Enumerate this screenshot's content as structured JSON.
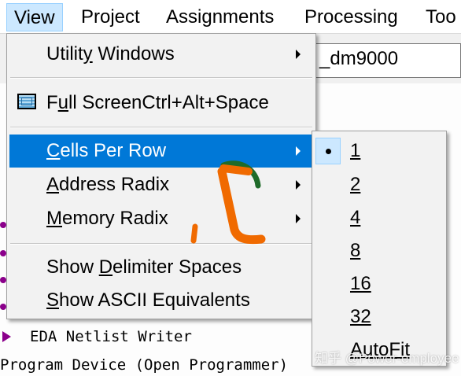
{
  "menubar": {
    "items": [
      {
        "label": "View",
        "active": true
      },
      {
        "label": "Project"
      },
      {
        "label": "Assignments"
      },
      {
        "label": "Processing"
      },
      {
        "label": "Too"
      }
    ]
  },
  "background": {
    "field_text": "_dm9000",
    "lines": [
      "EDA Netlist Writer",
      "Program Device (Open Programmer)"
    ]
  },
  "view_menu": {
    "items": [
      {
        "id": "utility-windows",
        "pre": "Utilit",
        "mnemonic": "y",
        "post": " Windows",
        "submenu": true
      },
      {
        "id": "full-screen",
        "pre": "F",
        "mnemonic": "u",
        "post": "ll ScreenCtrl+Alt+Space",
        "icon": "monitor-icon"
      },
      {
        "id": "cells-per-row",
        "pre": "",
        "mnemonic": "C",
        "post": "ells Per Row",
        "submenu": true,
        "highlighted": true
      },
      {
        "id": "address-radix",
        "pre": "",
        "mnemonic": "A",
        "post": "ddress Radix",
        "submenu": true
      },
      {
        "id": "memory-radix",
        "pre": "",
        "mnemonic": "M",
        "post": "emory Radix",
        "submenu": true
      },
      {
        "id": "show-delimiter-spaces",
        "pre": "Show ",
        "mnemonic": "D",
        "post": "elimiter Spaces"
      },
      {
        "id": "show-ascii-equivalents",
        "pre": "",
        "mnemonic": "S",
        "post": "how ASCII Equivalents"
      }
    ]
  },
  "cells_per_row_submenu": {
    "selected": "1",
    "options": [
      "1",
      "2",
      "4",
      "8",
      "16",
      "32",
      "AutoFit"
    ]
  },
  "watermark": "知乎 @Power-employee",
  "colors": {
    "highlight": "#0078d7",
    "annotation": "#f06a00",
    "annotation_tip": "#1f6b2a"
  }
}
